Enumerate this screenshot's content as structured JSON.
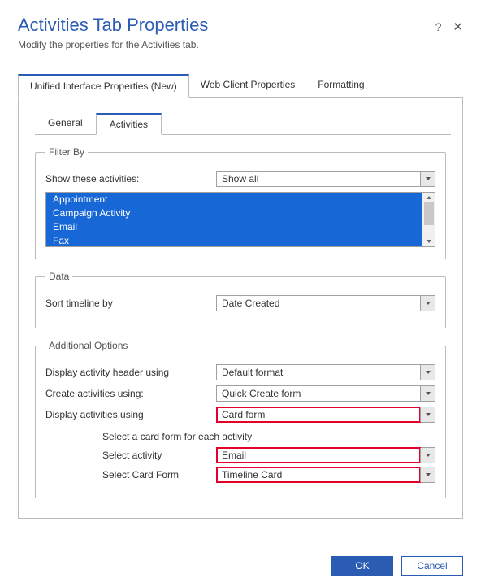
{
  "header": {
    "title": "Activities Tab Properties",
    "subtitle": "Modify the properties for the Activities tab."
  },
  "outerTabs": {
    "t0": "Unified Interface Properties (New)",
    "t1": "Web Client Properties",
    "t2": "Formatting"
  },
  "innerTabs": {
    "t0": "General",
    "t1": "Activities"
  },
  "filterBy": {
    "legend": "Filter By",
    "showLabel": "Show these activities:",
    "showValue": "Show all",
    "items": {
      "i0": "Appointment",
      "i1": "Campaign Activity",
      "i2": "Email",
      "i3": "Fax"
    }
  },
  "data": {
    "legend": "Data",
    "sortLabel": "Sort timeline by",
    "sortValue": "Date Created"
  },
  "additional": {
    "legend": "Additional Options",
    "headerLabel": "Display activity header using",
    "headerValue": "Default format",
    "createLabel": "Create activities using:",
    "createValue": "Quick Create form",
    "displayLabel": "Display activities using",
    "displayValue": "Card form",
    "cardIntro": "Select a card form for each activity",
    "selectActivityLabel": "Select activity",
    "selectActivityValue": "Email",
    "selectCardLabel": "Select Card Form",
    "selectCardValue": "Timeline Card"
  },
  "footer": {
    "ok": "OK",
    "cancel": "Cancel"
  }
}
